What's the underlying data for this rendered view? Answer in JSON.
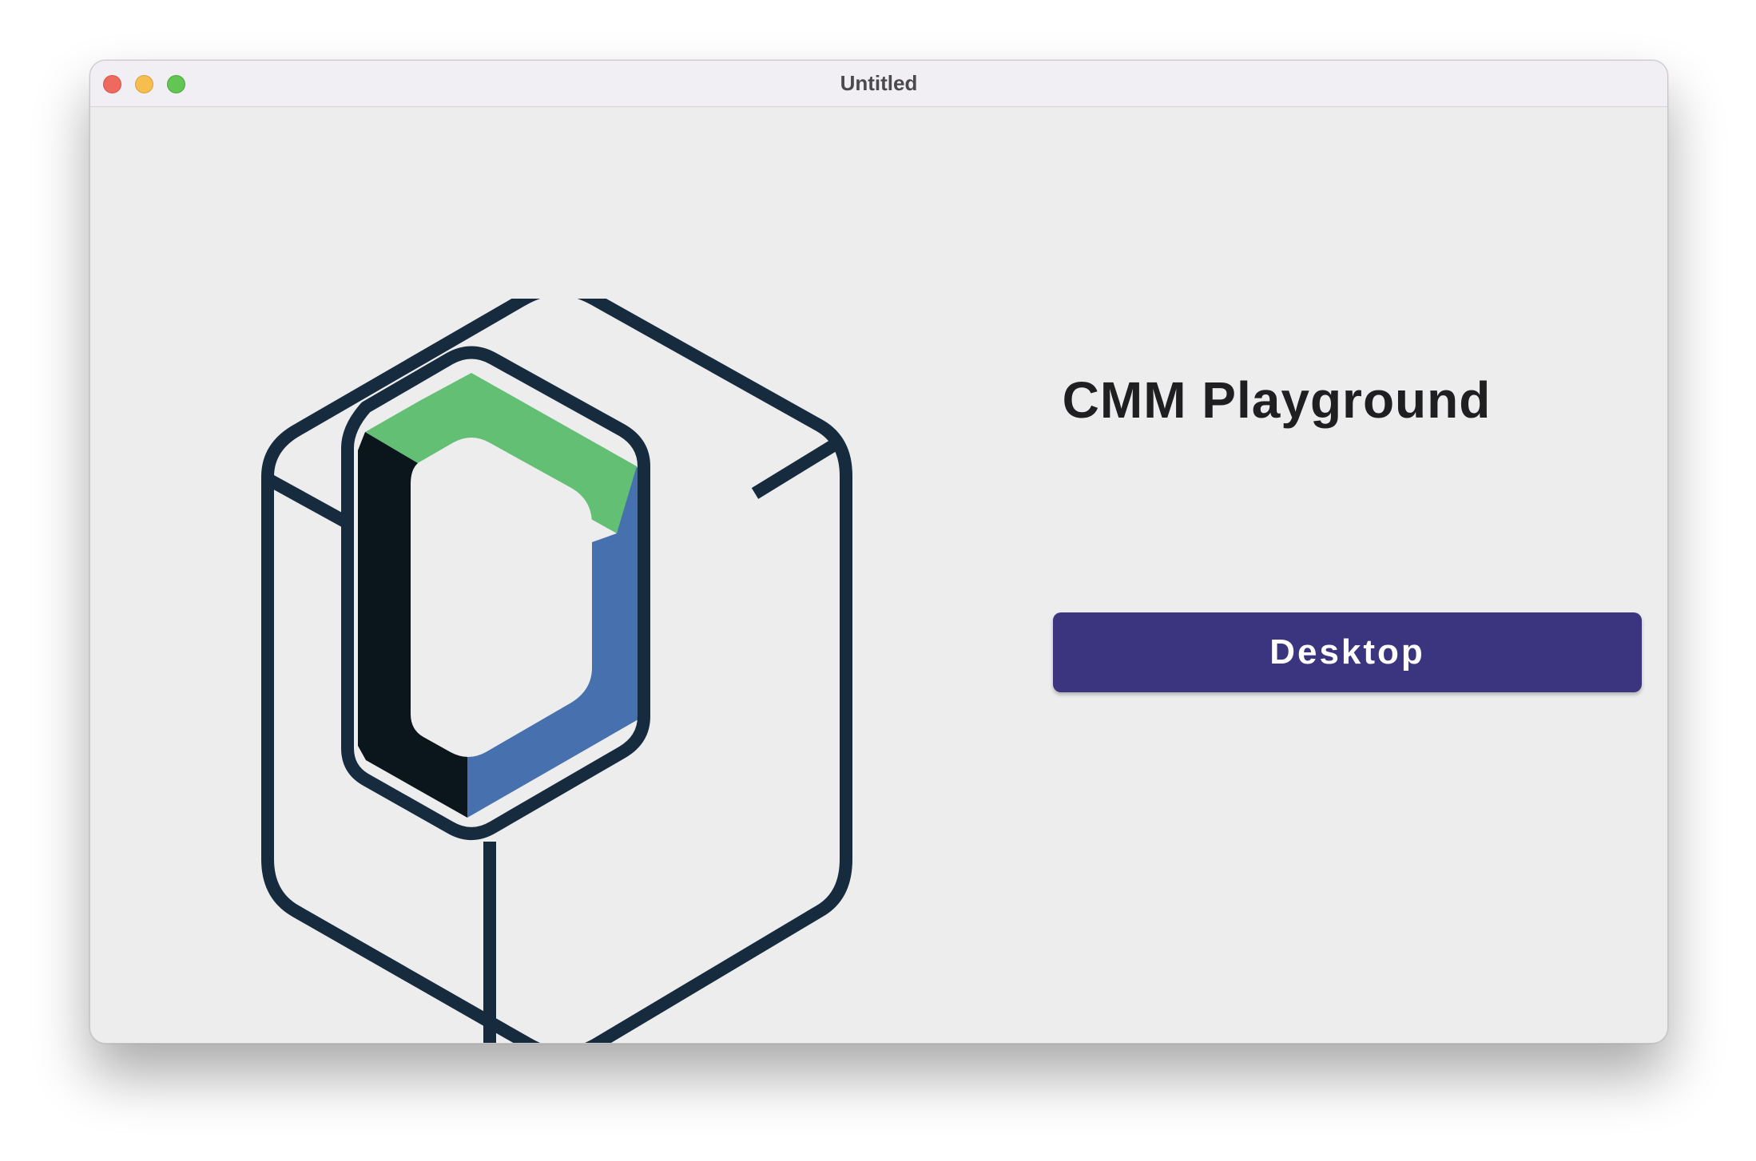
{
  "window": {
    "title": "Untitled"
  },
  "main": {
    "app_title": "CMM Playground",
    "desktop_button_label": "Desktop"
  },
  "colors": {
    "logo_outline": "#162b3e",
    "logo_green": "#62bf74",
    "logo_blue": "#4670ae",
    "logo_black": "#0a161b",
    "button_background": "#3b3580"
  },
  "icons": {
    "logo": "jetbrains-compose-multiplatform-cube-logo"
  }
}
